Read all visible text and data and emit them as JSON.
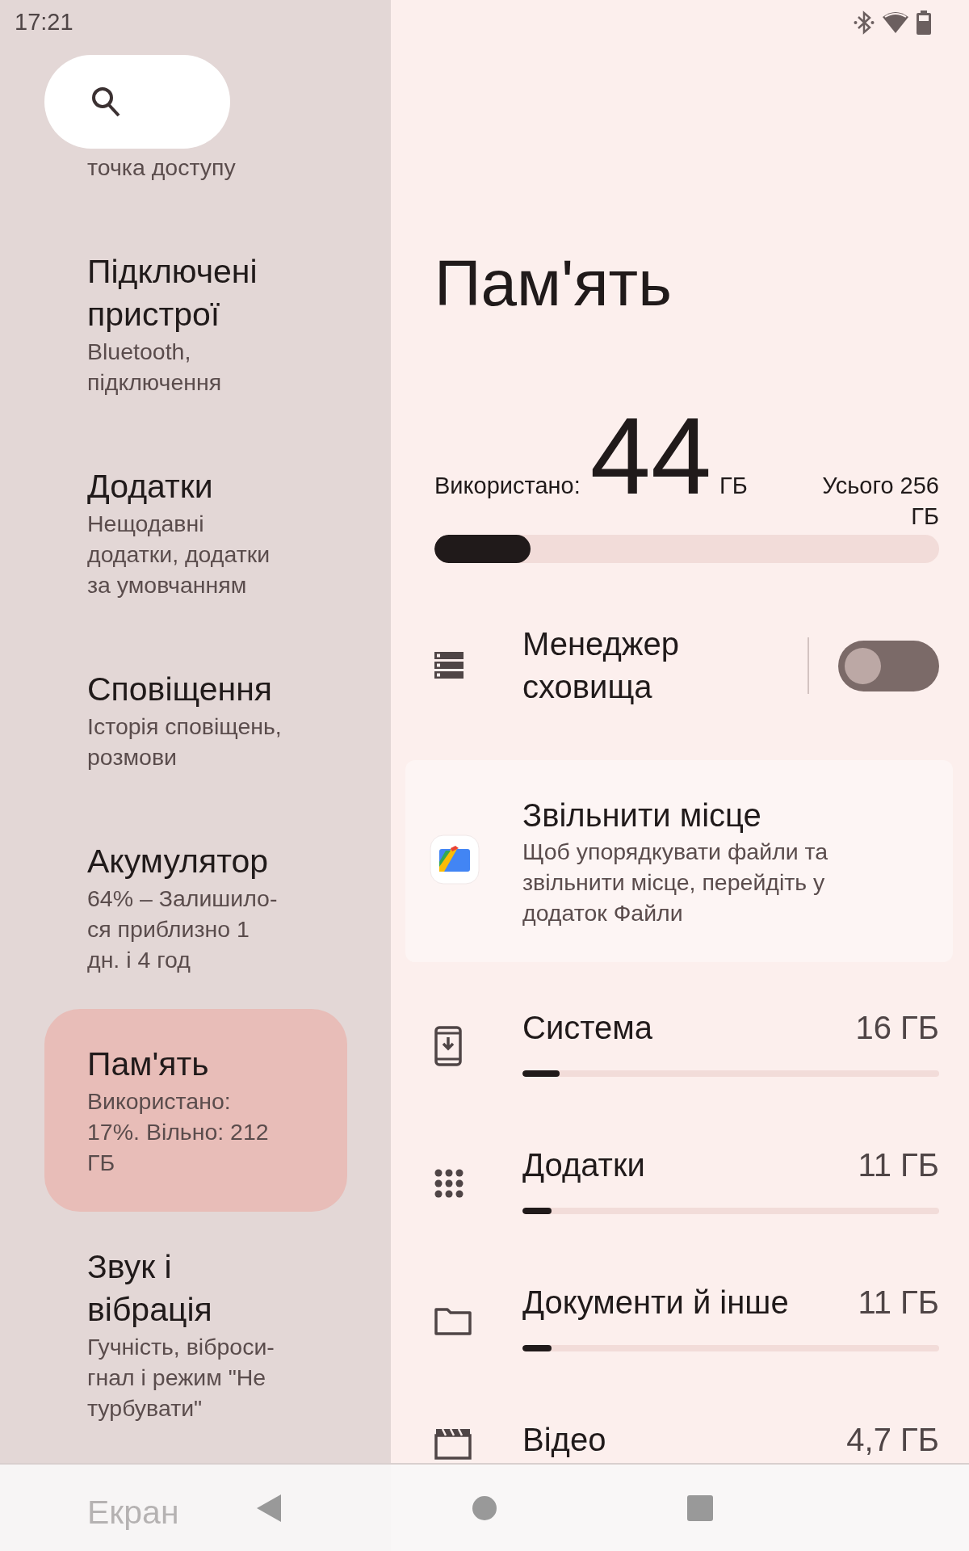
{
  "status_bar": {
    "time": "17:21"
  },
  "sidebar": {
    "items": [
      {
        "subtitle": "точка доступу",
        "selected": false
      },
      {
        "title": "Підключені пристрої",
        "subtitle": "Bluetooth, підключення",
        "selected": false
      },
      {
        "title": "Додатки",
        "subtitle": "Нещодавні додатки, додатки за умовчанням",
        "selected": false
      },
      {
        "title": "Сповіщення",
        "subtitle": "Історія сповіщень, розмови",
        "selected": false
      },
      {
        "title": "Акумулятор",
        "subtitle": "64% – Залишило-ся приблизно 1 дн. і 4 год",
        "selected": false
      },
      {
        "title": "Пам'ять",
        "subtitle": "Використано: 17%. Вільно: 212 ГБ",
        "selected": true
      },
      {
        "title": "Звук і вібрація",
        "subtitle": "Гучність, віброси-гнал і режим \"Не турбувати\"",
        "selected": false
      },
      {
        "title": "Екран",
        "selected": false
      }
    ]
  },
  "page": {
    "title": "Пам'ять",
    "usage": {
      "used_label": "Використано:",
      "used_value": "44",
      "used_unit": "ГБ",
      "total": "Усього 256 ГБ",
      "level": 0.19
    },
    "storage_manager": {
      "label": "Менеджер сховища",
      "on": false
    },
    "free_up_card": {
      "title": "Звільнити місце",
      "description": "Щоб упорядкувати файли та звільнити місце, перейдіть у додаток Файли"
    },
    "categories": [
      {
        "kind": "system",
        "name": "Система",
        "size": "16 ГБ",
        "level": 0.09
      },
      {
        "kind": "apps",
        "name": "Додатки",
        "size": "11 ГБ",
        "level": 0.07
      },
      {
        "kind": "documents",
        "name": "Документи й інше",
        "size": "11 ГБ",
        "level": 0.07
      },
      {
        "kind": "video",
        "name": "Відео",
        "size": "4,7 ГБ"
      }
    ]
  }
}
